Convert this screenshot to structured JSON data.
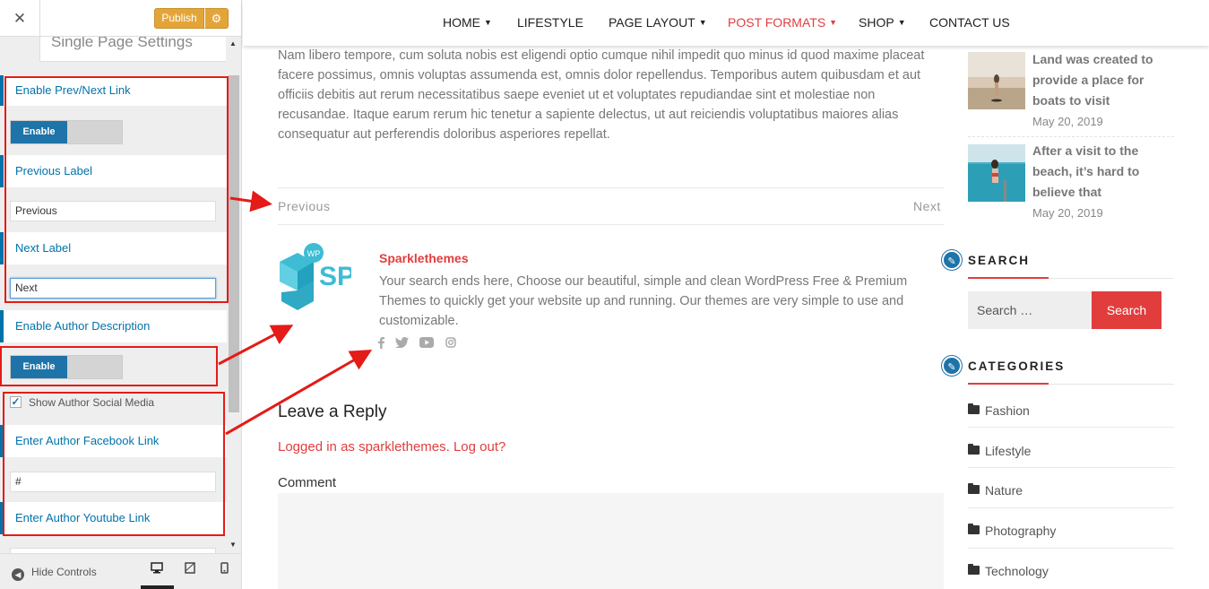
{
  "customizer": {
    "close_icon": "✕",
    "publish_label": "Publish",
    "gear_icon": "⚙",
    "section_title": "Single Page Settings",
    "enable_prev_next_label": "Enable Prev/Next Link",
    "toggle_on_label": "Enable",
    "previous_label_title": "Previous Label",
    "previous_label_value": "Previous",
    "next_label_title": "Next Label",
    "next_label_value": "Next",
    "enable_author_desc_label": "Enable Author Description",
    "show_author_social_label": "Show Author Social Media",
    "show_author_social_checked": true,
    "facebook_link_label": "Enter Author Facebook Link",
    "facebook_link_value": "#",
    "youtube_link_label": "Enter Author Youtube Link",
    "hide_controls_label": "Hide Controls",
    "devices": [
      "desktop-icon",
      "tablet-icon",
      "mobile-icon"
    ]
  },
  "nav": {
    "items": [
      {
        "label": "HOME",
        "dropdown": true
      },
      {
        "label": "LIFESTYLE",
        "dropdown": false
      },
      {
        "label": "PAGE LAYOUT",
        "dropdown": true
      },
      {
        "label": "POST FORMATS",
        "dropdown": true,
        "active": true
      },
      {
        "label": "SHOP",
        "dropdown": true
      },
      {
        "label": "CONTACT US",
        "dropdown": false
      }
    ]
  },
  "post": {
    "paragraph": "Nam libero tempore, cum soluta nobis est eligendi optio cumque nihil impedit quo minus id quod maxime placeat facere possimus, omnis voluptas assumenda est, omnis dolor repellendus. Temporibus autem quibusdam et aut officiis debitis aut rerum necessitatibus saepe eveniet ut et voluptates repudiandae sint et molestiae non recusandae. Itaque earum rerum hic tenetur a sapiente delectus, ut aut reiciendis voluptatibus maiores alias consequatur aut perferendis doloribus asperiores repellat.",
    "previous_link": "Previous",
    "next_link": "Next"
  },
  "author": {
    "logo_text": "SP",
    "logo_badge": "WP",
    "name": "Sparklethemes",
    "description": "Your search ends here, Choose our beautiful, simple and clean WordPress Free & Premium Themes to quickly get your website up and running. Our themes are very simple to use and customizable."
  },
  "comments": {
    "title": "Leave a Reply",
    "logged_in_text": "Logged in as sparklethemes. Log out?",
    "comment_label": "Comment"
  },
  "sidebar": {
    "posts": [
      {
        "title": "Land was created to provide a place for boats to visit",
        "date": "May 20, 2019"
      },
      {
        "title": "After a visit to the beach, it’s hard to believe that",
        "date": "May 20, 2019"
      }
    ],
    "search_title": "SEARCH",
    "search_placeholder": "Search …",
    "search_button": "Search",
    "categories_title": "CATEGORIES",
    "categories": [
      "Fashion",
      "Lifestyle",
      "Nature",
      "Photography",
      "Technology"
    ]
  },
  "colors": {
    "accent": "#e23d3d",
    "customizer_blue": "#0073aa",
    "publish": "#e4a538",
    "annotation": "#e41b17"
  }
}
